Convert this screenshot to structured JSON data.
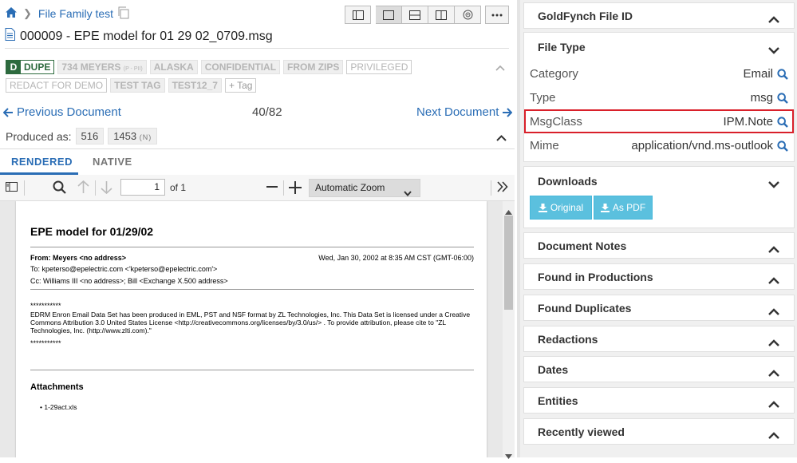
{
  "breadcrumb": {
    "home_icon": "home-icon",
    "folder": "File Family test"
  },
  "document": {
    "title": "000009 - EPE model for 01 29 02_0709.msg"
  },
  "tags": {
    "dupe_letter": "D",
    "dupe_label": "DUPE",
    "items": [
      {
        "label": "734 MEYERS",
        "suffix": "(P - PII)"
      },
      {
        "label": "ALASKA"
      },
      {
        "label": "CONFIDENTIAL"
      },
      {
        "label": "FROM ZIPS"
      },
      {
        "label": "PRIVILEGED"
      },
      {
        "label": "REDACT FOR DEMO"
      },
      {
        "label": "TEST TAG"
      },
      {
        "label": "TEST12_7"
      }
    ],
    "add_label": "Tag"
  },
  "navigation": {
    "prev": "Previous Document",
    "next": "Next Document",
    "count": "40/82"
  },
  "produced": {
    "label": "Produced as:",
    "values": [
      "516",
      "1453"
    ],
    "suffix": "(N)"
  },
  "tabs": {
    "rendered": "RENDERED",
    "native": "NATIVE"
  },
  "pdf_toolbar": {
    "page": "1",
    "of_total": "of 1",
    "zoom": "Automatic Zoom"
  },
  "pdf_page": {
    "title": "EPE model for 01/29/02",
    "from": "From: Meyers <no address>",
    "date": "Wed, Jan 30, 2002 at 8:35 AM CST (GMT-06:00)",
    "to": "To: kpeterso@epelectric.com <'kpeterso@epelectric.com'>",
    "cc": "Cc: Williams III <no address>; Bill <Exchange X.500 address>",
    "stars1": "***********",
    "body": "EDRM Enron Email Data Set has been produced in EML, PST and NSF format by ZL Technologies, Inc. This Data Set is licensed under a Creative Commons Attribution 3.0 United States License <http://creativecommons.org/licenses/by/3.0/us/> . To provide attribution, please cite to \"ZL Technologies, Inc. (http://www.zlti.com).\"",
    "stars2": "***********",
    "attachments_label": "Attachments",
    "attachment": "1-29act.xls"
  },
  "right_panel": {
    "goldfynch_id": "GoldFynch File ID",
    "file_type": {
      "title": "File Type",
      "rows": [
        {
          "key": "Category",
          "value": "Email"
        },
        {
          "key": "Type",
          "value": "msg"
        },
        {
          "key": "MsgClass",
          "value": "IPM.Note"
        },
        {
          "key": "Mime",
          "value": "application/vnd.ms-outlook"
        }
      ]
    },
    "downloads": {
      "title": "Downloads",
      "original": "Original",
      "pdf": "As PDF"
    },
    "sections": [
      "Document Notes",
      "Found in Productions",
      "Found Duplicates",
      "Redactions",
      "Dates",
      "Entities",
      "Recently viewed"
    ]
  },
  "colors": {
    "link": "#2a6db5",
    "dupe": "#2d6a3e",
    "highlight": "#d9202a",
    "download": "#5bc0de"
  }
}
